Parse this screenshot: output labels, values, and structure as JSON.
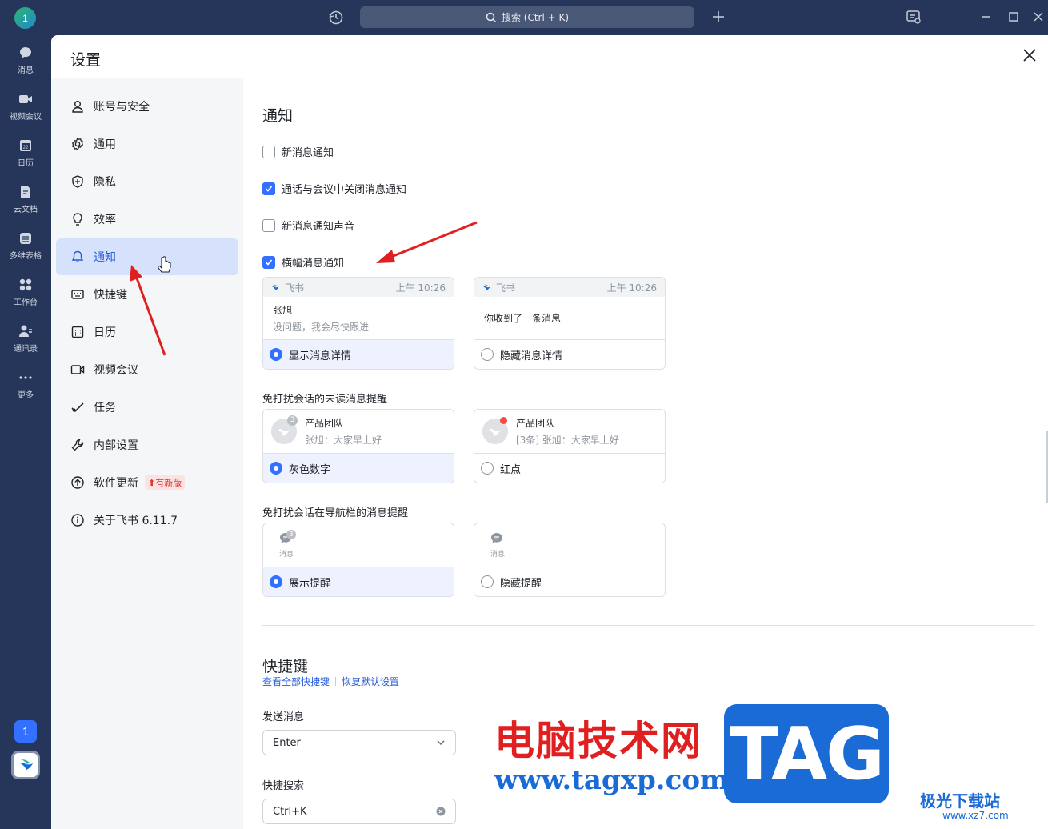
{
  "topbar": {
    "avatar": "1",
    "search_placeholder": "搜索 (Ctrl + K)"
  },
  "rail": {
    "items": [
      {
        "label": "消息",
        "icon": "chat-icon"
      },
      {
        "label": "视频会议",
        "icon": "video-icon"
      },
      {
        "label": "日历",
        "icon": "calendar-icon"
      },
      {
        "label": "云文档",
        "icon": "doc-icon"
      },
      {
        "label": "多维表格",
        "icon": "table-icon"
      },
      {
        "label": "工作台",
        "icon": "apps-icon"
      },
      {
        "label": "通讯录",
        "icon": "contacts-icon"
      },
      {
        "label": "更多",
        "icon": "more-icon"
      }
    ],
    "badge": "1"
  },
  "window": {
    "title": "设置"
  },
  "sidebar": {
    "items": [
      {
        "label": "账号与安全"
      },
      {
        "label": "通用"
      },
      {
        "label": "隐私"
      },
      {
        "label": "效率"
      },
      {
        "label": "通知"
      },
      {
        "label": "快捷键"
      },
      {
        "label": "日历"
      },
      {
        "label": "视频会议"
      },
      {
        "label": "任务"
      },
      {
        "label": "内部设置"
      },
      {
        "label": "软件更新"
      },
      {
        "label": "关于飞书 6.11.7"
      }
    ],
    "update_badge": "有新版"
  },
  "notify": {
    "title": "通知",
    "options": [
      {
        "label": "新消息通知",
        "checked": false
      },
      {
        "label": "通话与会议中关闭消息通知",
        "checked": true
      },
      {
        "label": "新消息通知声音",
        "checked": false
      },
      {
        "label": "横幅消息通知",
        "checked": true
      }
    ],
    "banner_cards": [
      {
        "app": "飞书",
        "time": "上午 10:26",
        "name": "张旭",
        "text": "没问题，我会尽快跟进",
        "option": "显示消息详情",
        "selected": true
      },
      {
        "app": "飞书",
        "time": "上午 10:26",
        "text": "你收到了一条消息",
        "option": "隐藏消息详情",
        "selected": false
      }
    ],
    "dnd_unread_label": "免打扰会话的未读消息提醒",
    "dnd_unread_cards": [
      {
        "name": "产品团队",
        "text": "张旭：大家早上好",
        "count": "3",
        "option": "灰色数字",
        "selected": true
      },
      {
        "name": "产品团队",
        "text": "[3条] 张旭：大家早上好",
        "option": "红点",
        "selected": false
      }
    ],
    "dnd_nav_label": "免打扰会话在导航栏的消息提醒",
    "dnd_nav_cards": [
      {
        "icon_label": "消息",
        "count": "3",
        "option": "展示提醒",
        "selected": true
      },
      {
        "icon_label": "消息",
        "option": "隐藏提醒",
        "selected": false
      }
    ]
  },
  "shortcuts": {
    "title": "快捷键",
    "view_all": "查看全部快捷键",
    "restore": "恢复默认设置",
    "send_label": "发送消息",
    "send_value": "Enter",
    "search_label": "快捷搜索",
    "search_value": "Ctrl+K"
  },
  "watermark": {
    "cn": "电脑技术网",
    "url": "www.tagxp.com",
    "tag": "TAG",
    "xz": "极光下载站",
    "xz_url": "www.xz7.com"
  },
  "colors": {
    "accent": "#3370ff",
    "rail_bg": "#26365a",
    "active_nav": "#d6e1fb",
    "arrow": "#e02020"
  }
}
